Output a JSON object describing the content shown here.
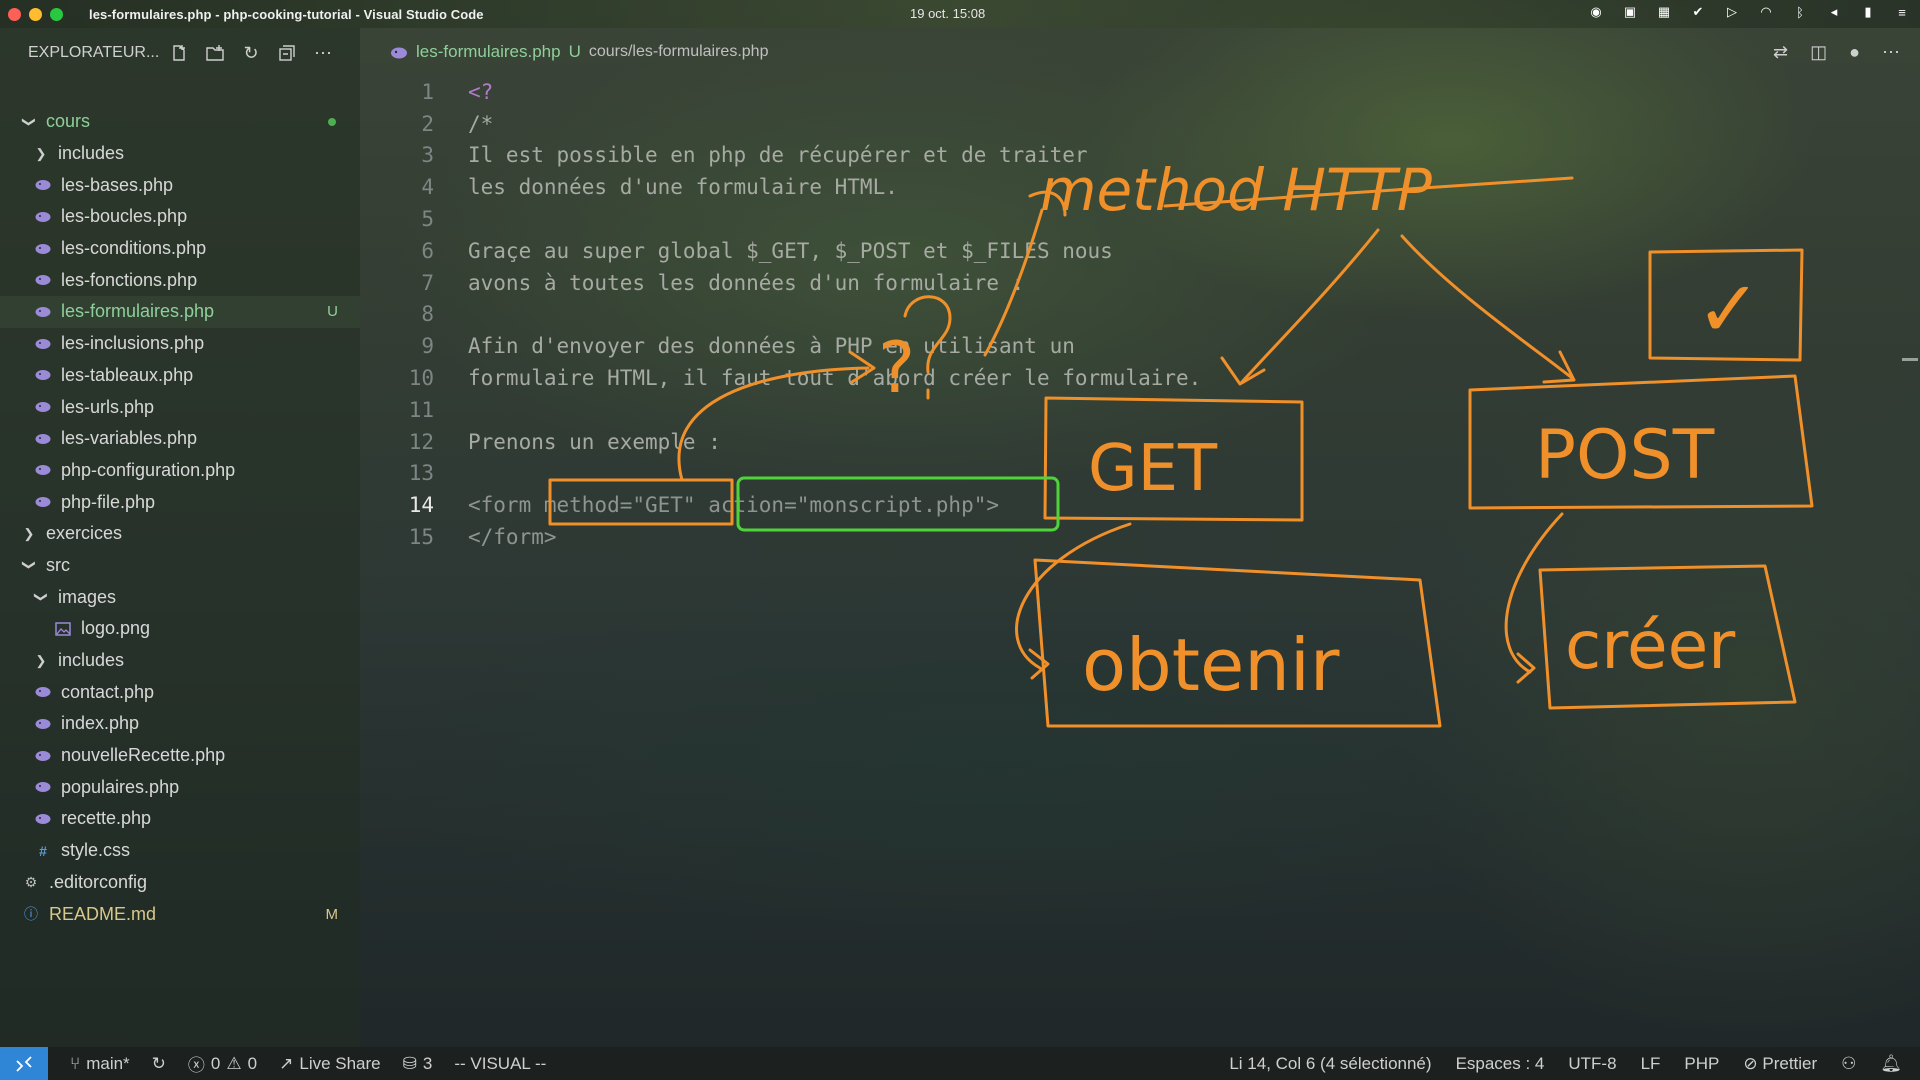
{
  "window": {
    "title": "les-formulaires.php - php-cooking-tutorial - Visual Studio Code",
    "clock": "19 oct.  15:08"
  },
  "explorer": {
    "title": "EXPLORATEUR..."
  },
  "tree": [
    {
      "label": "cours",
      "type": "folder-open",
      "depth": 0,
      "git": "dot",
      "color": "#8fcf9a"
    },
    {
      "label": "includes",
      "type": "folder",
      "depth": 1
    },
    {
      "label": "les-bases.php",
      "type": "php",
      "depth": 1
    },
    {
      "label": "les-boucles.php",
      "type": "php",
      "depth": 1
    },
    {
      "label": "les-conditions.php",
      "type": "php",
      "depth": 1
    },
    {
      "label": "les-fonctions.php",
      "type": "php",
      "depth": 1
    },
    {
      "label": "les-formulaires.php",
      "type": "php",
      "depth": 1,
      "active": true,
      "git": "U",
      "color": "#8fcf9a"
    },
    {
      "label": "les-inclusions.php",
      "type": "php",
      "depth": 1
    },
    {
      "label": "les-tableaux.php",
      "type": "php",
      "depth": 1
    },
    {
      "label": "les-urls.php",
      "type": "php",
      "depth": 1
    },
    {
      "label": "les-variables.php",
      "type": "php",
      "depth": 1
    },
    {
      "label": "php-configuration.php",
      "type": "php",
      "depth": 1
    },
    {
      "label": "php-file.php",
      "type": "php",
      "depth": 1
    },
    {
      "label": "exercices",
      "type": "folder",
      "depth": 0
    },
    {
      "label": "src",
      "type": "folder-open",
      "depth": 0
    },
    {
      "label": "images",
      "type": "folder-open",
      "depth": 1
    },
    {
      "label": "logo.png",
      "type": "image",
      "depth": 2
    },
    {
      "label": "includes",
      "type": "folder",
      "depth": 1
    },
    {
      "label": "contact.php",
      "type": "php",
      "depth": 1
    },
    {
      "label": "index.php",
      "type": "php",
      "depth": 1
    },
    {
      "label": "nouvelleRecette.php",
      "type": "php",
      "depth": 1
    },
    {
      "label": "populaires.php",
      "type": "php",
      "depth": 1
    },
    {
      "label": "recette.php",
      "type": "php",
      "depth": 1
    },
    {
      "label": "style.css",
      "type": "css",
      "depth": 1
    },
    {
      "label": ".editorconfig",
      "type": "gear",
      "depth": 0
    },
    {
      "label": "README.md",
      "type": "info",
      "depth": 0,
      "git": "M",
      "color": "#d8c88a"
    }
  ],
  "tab": {
    "name": "les-formulaires.php",
    "status": "U",
    "path": "cours/les-formulaires.php"
  },
  "code": [
    {
      "n": "1",
      "t": "<?"
    },
    {
      "n": "2",
      "t": "/*"
    },
    {
      "n": "3",
      "t": "Il est possible en php de récupérer et de traiter"
    },
    {
      "n": "4",
      "t": "les données d'une formulaire HTML."
    },
    {
      "n": "5",
      "t": ""
    },
    {
      "n": "6",
      "t": "Graçe au super global $_GET, $_POST et $_FILES nous"
    },
    {
      "n": "7",
      "t": "avons à toutes les données d'un formulaire :"
    },
    {
      "n": "8",
      "t": ""
    },
    {
      "n": "9",
      "t": "Afin d'envoyer des données à PHP en utilisant un"
    },
    {
      "n": "10",
      "t": "formulaire HTML, il faut tout d'abord créer le formulaire."
    },
    {
      "n": "11",
      "t": ""
    },
    {
      "n": "12",
      "t": "Prenons un exemple :"
    },
    {
      "n": "13",
      "t": ""
    },
    {
      "n": "14",
      "t": "<form method=\"GET\" action=\"monscript.php\">",
      "current": true
    },
    {
      "n": "15",
      "t": "</form>"
    }
  ],
  "annotations": {
    "method_http": "method HTTP",
    "get": "GET",
    "post": "POST",
    "obtenir": "obtenir",
    "creer": "créer",
    "question": "?",
    "check": "✓"
  },
  "status": {
    "branch": "main*",
    "errors": "0",
    "warnings": "0",
    "live_share": "Live Share",
    "files": "3",
    "mode": "-- VISUAL --",
    "position": "Li 14, Col 6 (4 sélectionné)",
    "indent": "Espaces : 4",
    "encoding": "UTF-8",
    "eol": "LF",
    "language": "PHP",
    "prettier": "Prettier"
  },
  "colors": {
    "accent": "#2f86d6",
    "annotation": "#f0902a",
    "highlight": "#4fd33a",
    "php_icon": "#9b8ad8"
  }
}
